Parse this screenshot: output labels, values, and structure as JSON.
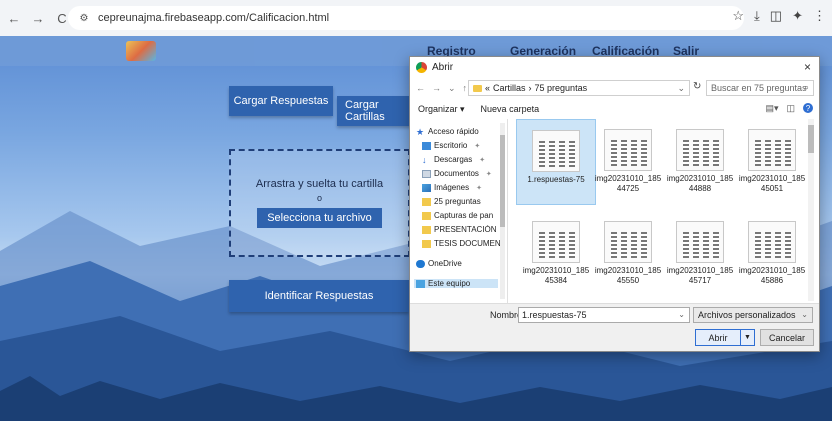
{
  "browser": {
    "url": "cepreunajma.firebaseapp.com/Calificacion.html",
    "back_icon": "←",
    "forward_icon": "→",
    "reload_icon": "C",
    "site_info_icon": "⚙",
    "star_icon": "☆",
    "download_icon": "⤓",
    "sidebar_icon": "◫",
    "extension_icon": "✦",
    "menu_icon": "⋮"
  },
  "site": {
    "nav": [
      "Registro",
      "Generación",
      "Calificación",
      "Salir"
    ],
    "load_answers_button": "Cargar Respuestas",
    "load_cards_button": "Cargar Cartillas",
    "drop_text": "Arrastra y suelta tu cartilla",
    "drop_or": "o",
    "select_file_button": "Selecciona tu archivo",
    "identify_button": "Identificar Respuestas"
  },
  "dialog": {
    "title": "Abrir",
    "close": "×",
    "path_prefix": "«",
    "path": [
      "Cartillas",
      "75 preguntas"
    ],
    "search_placeholder": "Buscar en 75 preguntas",
    "organize": "Organizar ▾",
    "new_folder": "Nueva carpeta",
    "help": "?",
    "nav_items": [
      {
        "label": "Acceso rápido",
        "icon": "star-icon"
      },
      {
        "label": "Escritorio",
        "icon": "desktop-icon"
      },
      {
        "label": "Descargas",
        "icon": "download-icon"
      },
      {
        "label": "Documentos",
        "icon": "documents-icon"
      },
      {
        "label": "Imágenes",
        "icon": "pictures-icon"
      },
      {
        "label": "25 preguntas",
        "icon": "folder-icon"
      },
      {
        "label": "Capturas de pan",
        "icon": "folder-icon"
      },
      {
        "label": "PRESENTACIÓN",
        "icon": "folder-icon"
      },
      {
        "label": "TESIS DOCUMEN",
        "icon": "folder-icon"
      },
      {
        "label": "OneDrive",
        "icon": "cloud-icon"
      },
      {
        "label": "Este equipo",
        "icon": "computer-icon"
      }
    ],
    "files": [
      "1.respuestas-75",
      "img20231010_185 44725",
      "img20231010_185 44888",
      "img20231010_185 45051",
      "img20231010_185 45384",
      "img20231010_185 45550",
      "img20231010_185 45717",
      "img20231010_185 45886"
    ],
    "filename_label": "Nombre:",
    "filename_value": "1.respuestas-75",
    "filter": "Archivos personalizados",
    "open_button": "Abrir",
    "cancel_button": "Cancelar"
  }
}
